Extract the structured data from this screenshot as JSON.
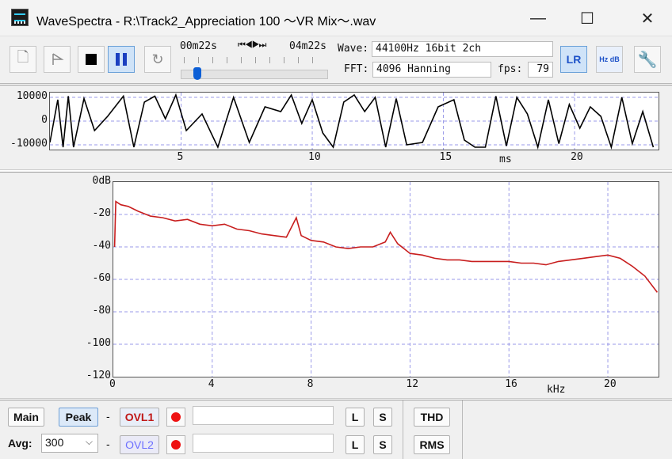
{
  "window": {
    "title": "WaveSpectra - R:\\Track2_Appreciation 100 ～VR Mix～.wav",
    "controls": {
      "minimize": "—",
      "maximize": "☐",
      "close": "✕"
    }
  },
  "toolbar": {
    "time_current": "00m22s",
    "time_total": "04m22s",
    "transport_arrows": "⏮◀▶⏭",
    "seek_fraction": 0.086,
    "wave_label": "Wave:",
    "wave_value": "44100Hz 16bit 2ch",
    "fft_label": "FFT:",
    "fft_value": "4096 Hanning",
    "fps_label": "fps:",
    "fps_value": "79",
    "lr_label": "LR",
    "hzdb_label": "Hz dB",
    "icons": [
      "open-file-icon",
      "play-icon",
      "stop-icon",
      "pause-icon",
      "loop-icon",
      "channel-lr-icon",
      "hz-db-scale-icon",
      "wrench-icon"
    ]
  },
  "waveform": {
    "y_ticks": [
      "10000",
      "0",
      "-10000"
    ],
    "x_ticks": [
      "5",
      "10",
      "15",
      "20"
    ],
    "x_unit": "ms"
  },
  "spectrum": {
    "y_ticks": [
      "0dB",
      "-20",
      "-40",
      "-60",
      "-80",
      "-100",
      "-120"
    ],
    "x_ticks": [
      "0",
      "4",
      "8",
      "12",
      "16",
      "20"
    ],
    "x_unit": "kHz",
    "trace_color": "#c81e1e"
  },
  "bottom": {
    "main_label": "Main",
    "peak_label": "Peak",
    "dash": "-",
    "ovl1_label": "OVL1",
    "ovl2_label": "OVL2",
    "l_label": "L",
    "s_label": "S",
    "avg_label": "Avg:",
    "avg_value": "300",
    "thd_label": "THD",
    "rms_label": "RMS"
  },
  "chart_data": [
    {
      "type": "line",
      "title": "",
      "xlabel": "ms",
      "ylabel": "",
      "xlim": [
        0,
        23.2
      ],
      "ylim": [
        -12000,
        12000
      ],
      "x_ticks": [
        5,
        10,
        15,
        20
      ],
      "y_ticks": [
        10000,
        0,
        -10000
      ],
      "grid": true,
      "series": [
        {
          "color": "#000000",
          "x": [
            0,
            0.3,
            0.5,
            0.7,
            0.9,
            1.3,
            1.7,
            2.2,
            2.8,
            3.2,
            3.6,
            4.0,
            4.4,
            4.8,
            5.2,
            5.8,
            6.4,
            7.0,
            7.6,
            8.2,
            8.8,
            9.2,
            9.6,
            10.0,
            10.4,
            10.8,
            11.2,
            11.6,
            12.0,
            12.4,
            12.8,
            13.2,
            13.6,
            14.2,
            14.8,
            15.4,
            15.8,
            16.2,
            16.6,
            17.0,
            17.4,
            17.8,
            18.2,
            18.6,
            19.0,
            19.4,
            19.8,
            20.2,
            20.6,
            21.0,
            21.4,
            21.8,
            22.2,
            22.6,
            23.0
          ],
          "y": [
            -9000,
            9000,
            -11000,
            10500,
            -11000,
            9500,
            -4000,
            2000,
            10500,
            -11000,
            8000,
            10500,
            1000,
            11000,
            -4000,
            3000,
            -11000,
            10000,
            -9000,
            6000,
            4000,
            11000,
            -1000,
            9000,
            -5000,
            -11000,
            8000,
            11000,
            4000,
            10000,
            -11000,
            9500,
            -10000,
            -9000,
            6000,
            9000,
            -8000,
            -11000,
            -11000,
            10500,
            -10500,
            10000,
            3000,
            -11000,
            9000,
            -9500,
            7000,
            -3000,
            6000,
            2000,
            -11000,
            10000,
            -9500,
            4000,
            -11000
          ]
        }
      ]
    },
    {
      "type": "line",
      "title": "",
      "xlabel": "kHz",
      "ylabel": "",
      "xlim": [
        0,
        22.05
      ],
      "ylim": [
        -120,
        0
      ],
      "x_ticks": [
        0,
        4,
        8,
        12,
        16,
        20
      ],
      "y_ticks": [
        0,
        -20,
        -40,
        -60,
        -80,
        -100,
        -120
      ],
      "grid": true,
      "series": [
        {
          "color": "#c81e1e",
          "x": [
            0.05,
            0.1,
            0.3,
            0.6,
            1.0,
            1.5,
            2.0,
            2.5,
            3.0,
            3.5,
            4.0,
            4.5,
            5.0,
            5.5,
            6.0,
            6.5,
            7.0,
            7.4,
            7.6,
            8.0,
            8.5,
            9.0,
            9.5,
            10.0,
            10.5,
            11.0,
            11.2,
            11.5,
            12.0,
            12.5,
            13.0,
            13.5,
            14.0,
            14.5,
            15.0,
            15.5,
            16.0,
            16.5,
            17.0,
            17.5,
            18.0,
            18.5,
            19.0,
            19.5,
            20.0,
            20.5,
            21.0,
            21.5,
            22.0
          ],
          "y": [
            -40,
            -12,
            -14,
            -15,
            -18,
            -21,
            -22,
            -24,
            -23,
            -26,
            -27,
            -26,
            -29,
            -30,
            -32,
            -33,
            -34,
            -22,
            -33,
            -36,
            -37,
            -40,
            -41,
            -40,
            -40,
            -37,
            -31,
            -38,
            -44,
            -45,
            -47,
            -48,
            -48,
            -49,
            -49,
            -49,
            -49,
            -50,
            -50,
            -51,
            -49,
            -48,
            -47,
            -46,
            -45,
            -47,
            -52,
            -58,
            -68
          ]
        }
      ]
    }
  ]
}
